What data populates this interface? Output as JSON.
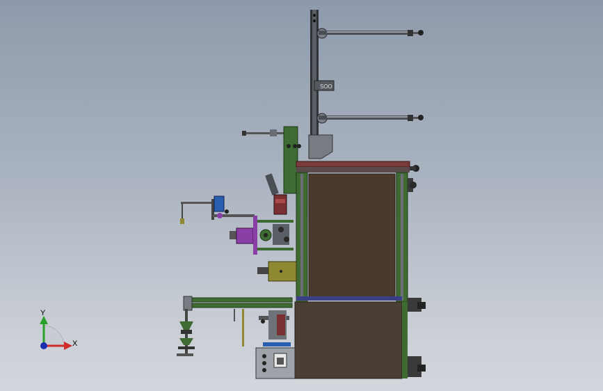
{
  "viewport": {
    "background_top": "#8e9aab",
    "background_bottom": "#d3d6dc"
  },
  "model": {
    "colors": {
      "frame_green": "#3d6b32",
      "panel_brown": "#4a3a2c",
      "steel_grey": "#6e737a",
      "dark_rail": "#2f3237",
      "accent_blue": "#2a5fb0",
      "accent_purple": "#8a3fa6",
      "accent_yellow": "#8f8a32",
      "top_red": "#7a3a3a"
    },
    "bracket_label": "SOO"
  },
  "triad": {
    "x_label": "X",
    "y_label": "Y",
    "x_color": "#d12a2a",
    "y_color": "#2aa02a",
    "z_color": "#1a2fb0"
  }
}
